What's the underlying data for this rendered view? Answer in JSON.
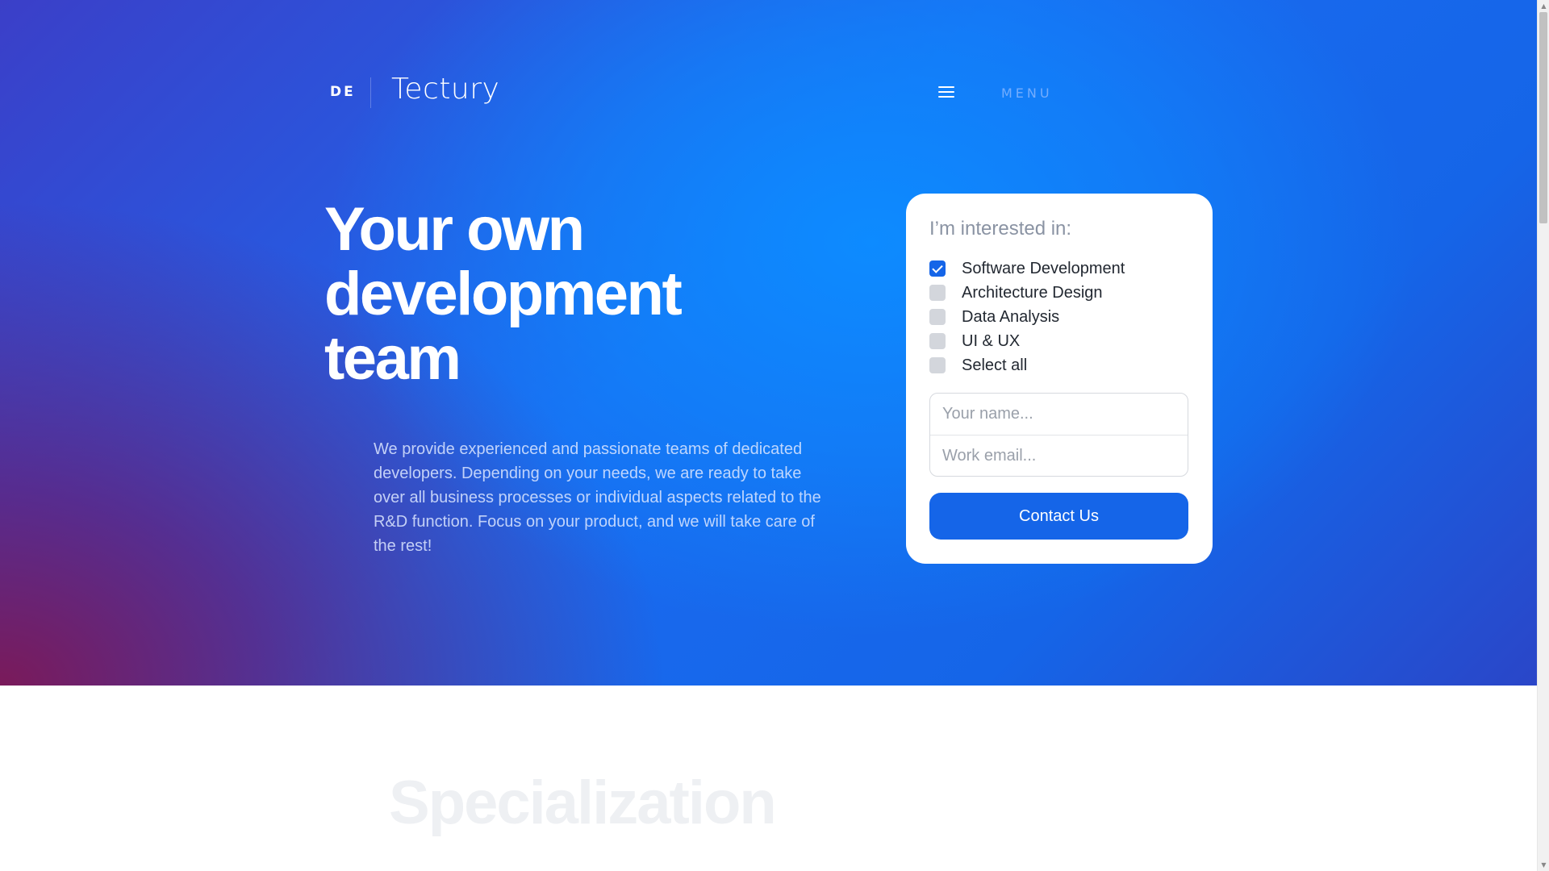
{
  "header": {
    "lang": "DE",
    "logo": "Tectury",
    "menu_label": "MENU",
    "menu_icon": "hamburger-icon"
  },
  "hero": {
    "headline": [
      "Your own",
      "development",
      "team"
    ],
    "intro": "We provide experienced and passionate teams of dedicated developers. Depending on your needs, we are ready to take over all business processes or individual aspects related to the R&D function. Focus on your product, and we will take care of the rest!"
  },
  "form": {
    "title": "I’m interested in:",
    "options": [
      {
        "label": "Software Development",
        "checked": true
      },
      {
        "label": "Architecture Design",
        "checked": false
      },
      {
        "label": "Data Analysis",
        "checked": false
      },
      {
        "label": "UI & UX",
        "checked": false
      },
      {
        "label": "Select all",
        "checked": false
      }
    ],
    "name_placeholder": "Your name...",
    "email_placeholder": "Work email...",
    "submit_label": "Contact Us"
  },
  "specialization": {
    "title": "Specialization"
  },
  "colors": {
    "accent": "#1565e8",
    "hero_blue": "#0d8bff",
    "hero_purple": "#7a1a5a"
  }
}
